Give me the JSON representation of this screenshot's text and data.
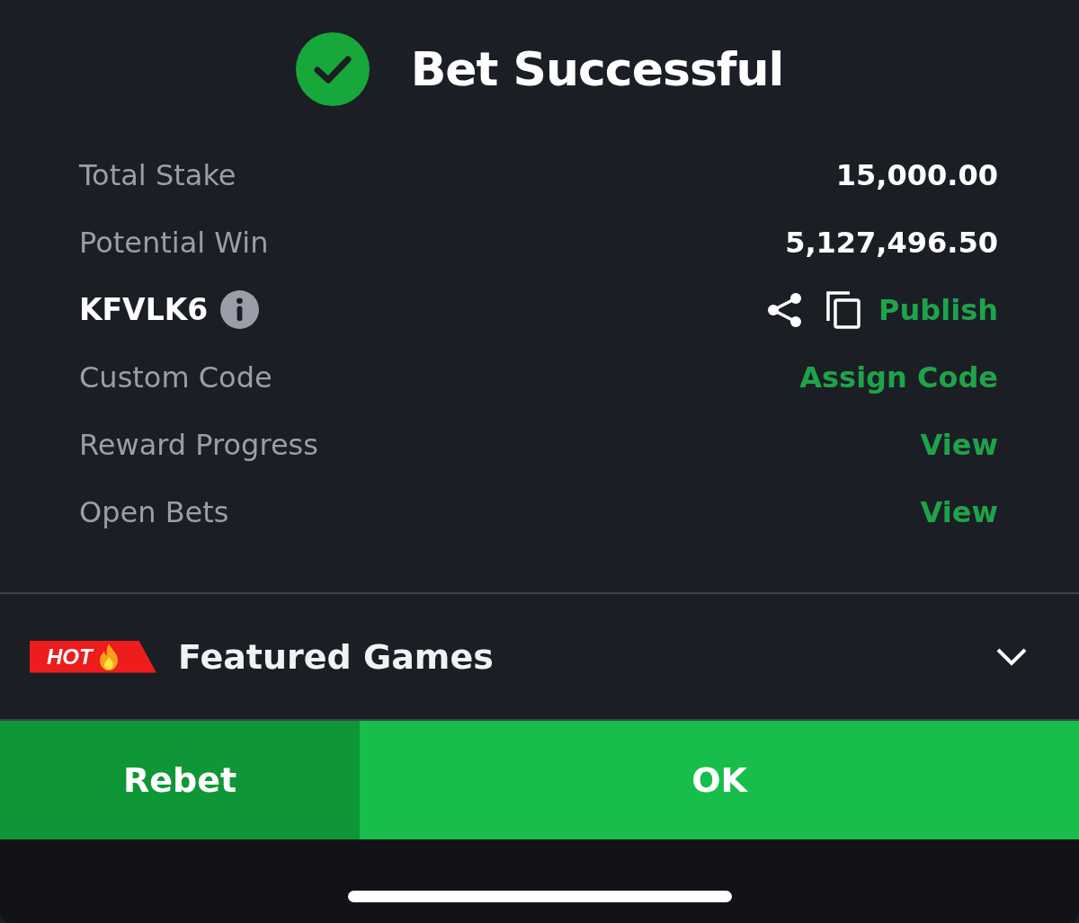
{
  "header": {
    "title": "Bet Successful"
  },
  "summary_rows": [
    {
      "kind": "value",
      "label": "Total Stake",
      "value": "15,000.00"
    },
    {
      "kind": "value",
      "label": "Potential Win",
      "value": "5,127,496.50"
    },
    {
      "kind": "booking_code",
      "code": "KFVLK6",
      "action": "Publish"
    },
    {
      "kind": "link",
      "label": "Custom Code",
      "action": "Assign Code"
    },
    {
      "kind": "link",
      "label": "Reward Progress",
      "action": "View"
    },
    {
      "kind": "link",
      "label": "Open Bets",
      "action": "View"
    }
  ],
  "featured_games": {
    "badge": "HOT",
    "title": "Featured Games",
    "expanded": false
  },
  "buttons": [
    {
      "kind": "secondary",
      "label": "Rebet"
    },
    {
      "kind": "primary",
      "label": "OK"
    }
  ]
}
